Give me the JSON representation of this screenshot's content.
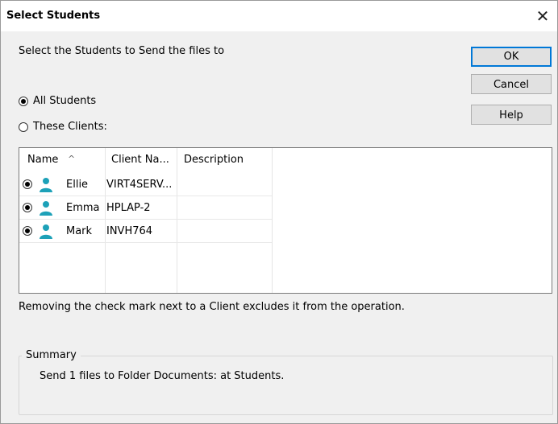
{
  "dialog": {
    "title": "Select Students",
    "prompt": "Select the Students to Send the files to",
    "close_icon": "close-icon",
    "buttons": {
      "ok": "OK",
      "cancel": "Cancel",
      "help": "Help"
    },
    "options": [
      {
        "label": "All Students",
        "selected": true
      },
      {
        "label": "These Clients:",
        "selected": false
      }
    ],
    "list": {
      "columns": [
        "Name",
        "Client Na...",
        "Description"
      ],
      "rows": [
        {
          "name": "Ellie",
          "client": "VIRT4SERV...",
          "description": "",
          "selected": true,
          "icon": "user-icon"
        },
        {
          "name": "Emma",
          "client": "HPLAP-2",
          "description": "",
          "selected": true,
          "icon": "user-icon"
        },
        {
          "name": "Mark",
          "client": "INVH764",
          "description": "",
          "selected": true,
          "icon": "user-icon"
        }
      ]
    },
    "note": "Removing the check mark next to a Client excludes it from the operation.",
    "summary": {
      "title": "Summary",
      "text": "Send 1 files to Folder Documents: at Students."
    },
    "colors": {
      "accent": "#0078d7",
      "user_icon": "#1da1b8"
    }
  }
}
